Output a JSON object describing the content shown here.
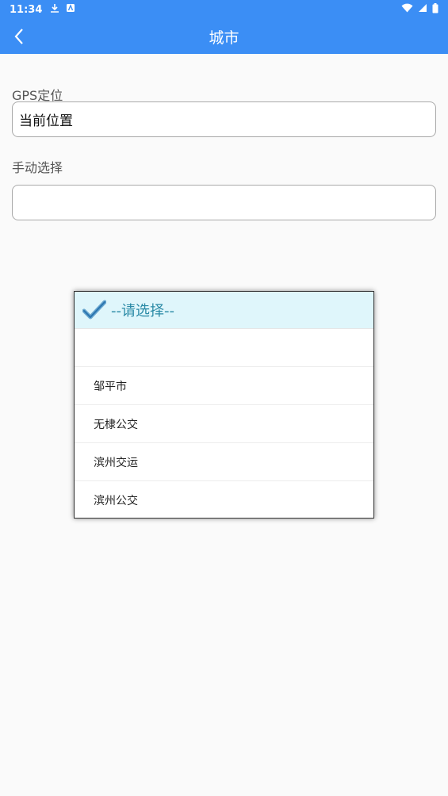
{
  "status": {
    "time": "11:34"
  },
  "appbar": {
    "title": "城市"
  },
  "gps": {
    "label": "GPS定位",
    "value": "当前位置"
  },
  "manual": {
    "label": "手动选择",
    "value": ""
  },
  "dialog": {
    "title": "--请选择--",
    "options": [
      "",
      "邹平市",
      "无棣公交",
      "滨州交运",
      "滨州公交"
    ]
  },
  "colors": {
    "primary": "#3b8ef5",
    "dialog_header": "#dff6fb",
    "dialog_title": "#2a8aa6"
  }
}
